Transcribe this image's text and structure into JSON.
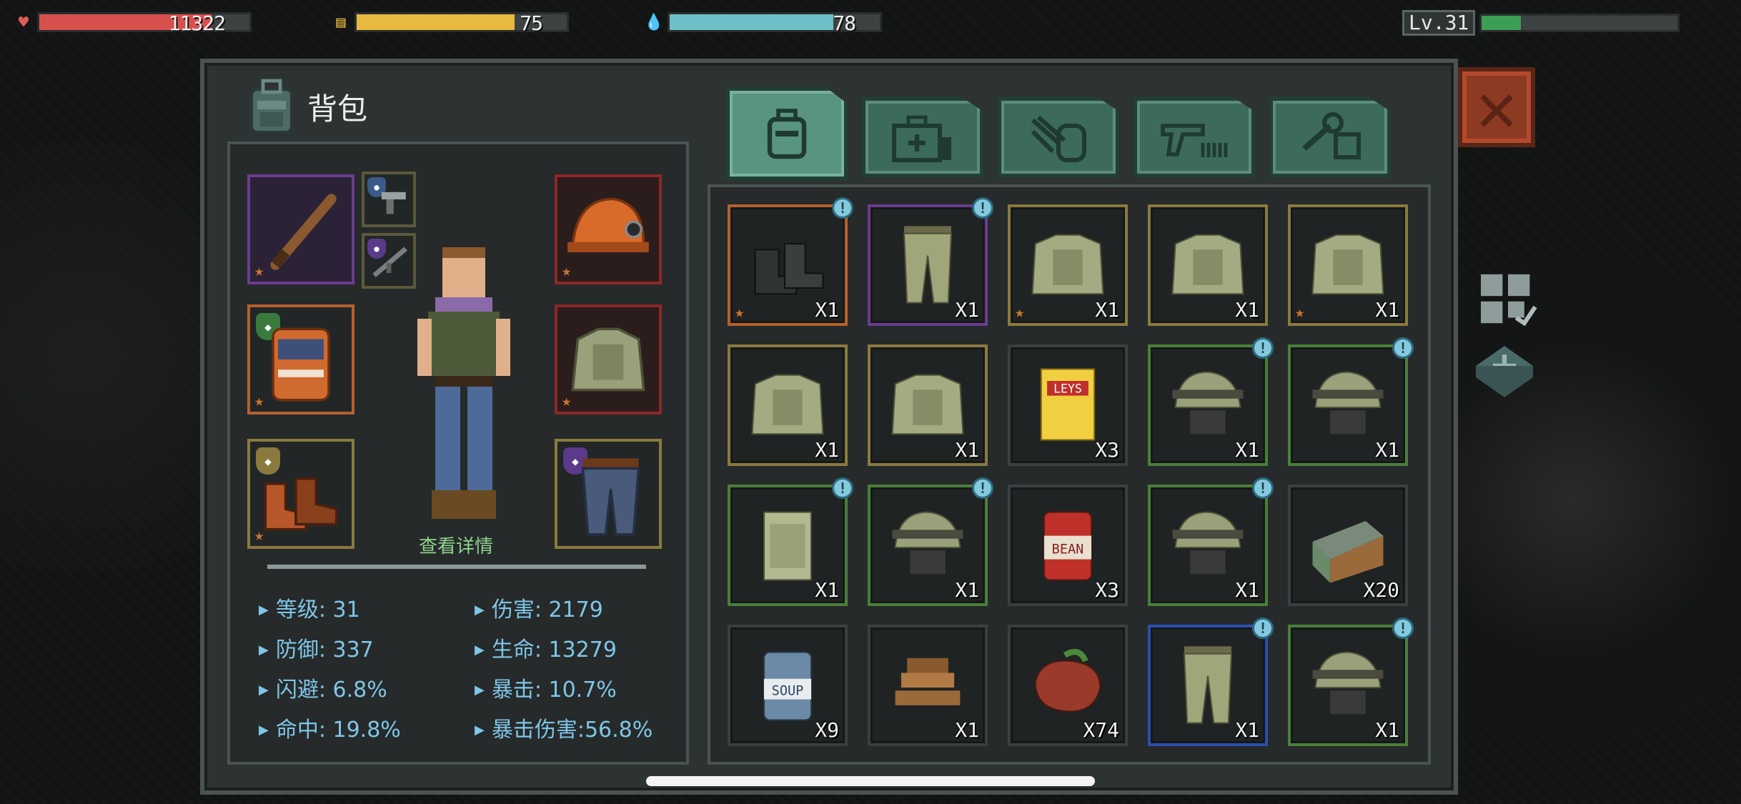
{
  "hud": {
    "health": {
      "value": "11322",
      "fill": 0.82,
      "color": "#d8504e"
    },
    "hunger": {
      "value": "75",
      "fill": 0.75,
      "color": "#e7b93f"
    },
    "water": {
      "value": "78",
      "fill": 0.78,
      "color": "#6ec0c8"
    },
    "level": {
      "label": "Lv.31",
      "fill": 0.2
    }
  },
  "panel": {
    "title": "背包"
  },
  "character": {
    "detail_link": "查看详情"
  },
  "stats": [
    {
      "text": "等级: 31"
    },
    {
      "text": "伤害: 2179"
    },
    {
      "text": "防御: 337"
    },
    {
      "text": "生命: 13279"
    },
    {
      "text": "闪避: 6.8%"
    },
    {
      "text": "暴击: 10.7%"
    },
    {
      "text": "命中: 19.8%"
    },
    {
      "text": "暴击伤害:56.8%"
    }
  ],
  "tabs": [
    {
      "name": "backpack",
      "icon": "backpack-icon",
      "active": true
    },
    {
      "name": "medical",
      "icon": "medkit-icon",
      "active": false
    },
    {
      "name": "materials",
      "icon": "materials-icon",
      "active": false
    },
    {
      "name": "weapons",
      "icon": "gun-ammo-icon",
      "active": false
    },
    {
      "name": "tools",
      "icon": "wrench-icon",
      "active": false
    }
  ],
  "inventory": [
    {
      "item": "combat-boots",
      "qty": "X1",
      "rarity": "orange",
      "alert": true,
      "star": true
    },
    {
      "item": "camo-pants",
      "qty": "X1",
      "rarity": "purple",
      "alert": true,
      "star": false
    },
    {
      "item": "tactical-jacket",
      "qty": "X1",
      "rarity": "gold",
      "alert": false,
      "star": true
    },
    {
      "item": "tactical-jacket",
      "qty": "X1",
      "rarity": "gold",
      "alert": false,
      "star": false
    },
    {
      "item": "tactical-jacket",
      "qty": "X1",
      "rarity": "gold",
      "alert": false,
      "star": true
    },
    {
      "item": "tactical-jacket",
      "qty": "X1",
      "rarity": "gold",
      "alert": false,
      "star": false
    },
    {
      "item": "tactical-jacket",
      "qty": "X1",
      "rarity": "gold",
      "alert": false,
      "star": false
    },
    {
      "item": "leys-chips",
      "qty": "X3",
      "rarity": "none",
      "alert": false,
      "star": false
    },
    {
      "item": "military-helmet",
      "qty": "X1",
      "rarity": "green",
      "alert": true,
      "star": false
    },
    {
      "item": "military-helmet",
      "qty": "X1",
      "rarity": "green",
      "alert": true,
      "star": false
    },
    {
      "item": "body-armor-vest",
      "qty": "X1",
      "rarity": "green",
      "alert": true,
      "star": false
    },
    {
      "item": "military-helmet",
      "qty": "X1",
      "rarity": "green",
      "alert": true,
      "star": false
    },
    {
      "item": "bean-can",
      "qty": "X3",
      "rarity": "none",
      "alert": false,
      "star": false
    },
    {
      "item": "military-helmet",
      "qty": "X1",
      "rarity": "green",
      "alert": true,
      "star": false
    },
    {
      "item": "ammo-box",
      "qty": "X20",
      "rarity": "none",
      "alert": false,
      "star": false
    },
    {
      "item": "soup-can",
      "qty": "X9",
      "rarity": "none",
      "alert": false,
      "star": false
    },
    {
      "item": "firewood",
      "qty": "X1",
      "rarity": "none",
      "alert": false,
      "star": false
    },
    {
      "item": "steak",
      "qty": "X74",
      "rarity": "none",
      "alert": false,
      "star": false
    },
    {
      "item": "camo-pants",
      "qty": "X1",
      "rarity": "blue",
      "alert": true,
      "star": false
    },
    {
      "item": "military-helmet",
      "qty": "X1",
      "rarity": "green",
      "alert": true,
      "star": false
    }
  ],
  "equipment": [
    {
      "slot": "weapon",
      "item": "baseball-bat",
      "rarity": "purple"
    },
    {
      "slot": "sidearm",
      "item": "pistol",
      "rarity": "none"
    },
    {
      "slot": "rifle",
      "item": "assault-rifle",
      "rarity": "none"
    },
    {
      "slot": "head",
      "item": "mining-helmet",
      "rarity": "red"
    },
    {
      "slot": "back",
      "item": "orange-backpack",
      "rarity": "orange"
    },
    {
      "slot": "body",
      "item": "tactical-jacket",
      "rarity": "red"
    },
    {
      "slot": "feet",
      "item": "brown-boots",
      "rarity": "gold"
    },
    {
      "slot": "legs",
      "item": "jeans-with-belt",
      "rarity": "gold"
    }
  ],
  "rarity_colors": {
    "purple": "#6a3d8f",
    "orange": "#b5602c",
    "gold": "#8a7a3e",
    "green": "#4a7f3a",
    "blue": "#2b4fae",
    "red": "#8d2727",
    "none": "#3a3f3f"
  }
}
